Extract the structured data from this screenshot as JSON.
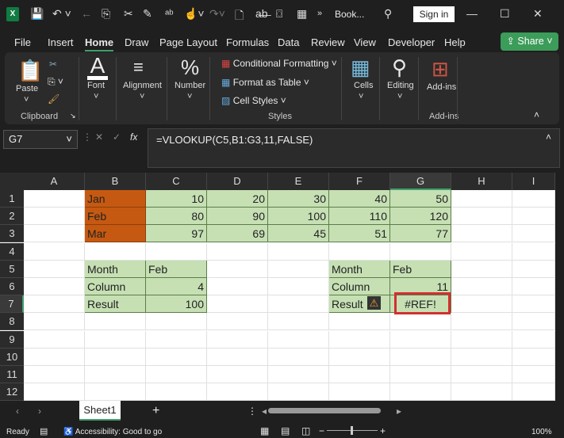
{
  "title": {
    "doc": "Book...",
    "signin": "Sign in",
    "overflow": "»"
  },
  "menu": [
    "File",
    "Insert",
    "Home",
    "Draw",
    "Page Layout",
    "Formulas",
    "Data",
    "Review",
    "View",
    "Developer",
    "Help"
  ],
  "share": "Share",
  "ribbon": {
    "paste": "Paste",
    "clipboard": "Clipboard",
    "font": "Font",
    "alignment": "Alignment",
    "number": "Number",
    "cond": "Conditional Formatting",
    "fmt_table": "Format as Table",
    "cell_styles": "Cell Styles",
    "styles": "Styles",
    "cells": "Cells",
    "editing": "Editing",
    "addins": "Add-ins",
    "addins_group": "Add-ins"
  },
  "formula_bar": {
    "name_box": "G7",
    "fx": "fx",
    "formula": "=VLOOKUP(C5,B1:G3,11,FALSE)"
  },
  "columns": [
    "A",
    "B",
    "C",
    "D",
    "E",
    "F",
    "G",
    "H",
    "I"
  ],
  "rows": [
    "1",
    "2",
    "3",
    "4",
    "5",
    "6",
    "7",
    "8",
    "9",
    "10",
    "11",
    "12"
  ],
  "cells": {
    "B1": "Jan",
    "C1": "10",
    "D1": "20",
    "E1": "30",
    "F1": "40",
    "G1": "50",
    "B2": "Feb",
    "C2": "80",
    "D2": "90",
    "E2": "100",
    "F2": "110",
    "G2": "120",
    "B3": "Mar",
    "C3": "97",
    "D3": "69",
    "E3": "45",
    "F3": "51",
    "G3": "77",
    "B5": "Month",
    "C5": "Feb",
    "B6": "Column",
    "C6": "4",
    "B7": "Result",
    "C7": "100",
    "F5": "Month",
    "G5": "Feb",
    "F6": "Column",
    "G6": "11",
    "F7": "Result",
    "G7": "#REF!"
  },
  "sheet_tab": "Sheet1",
  "status": {
    "ready": "Ready",
    "accessibility": "Accessibility: Good to go",
    "zoom": "100%"
  },
  "colors": {
    "orange": "#c65911",
    "green": "#c6e0b4",
    "error_border": "#d32f2f",
    "accent": "#3fa06a"
  }
}
